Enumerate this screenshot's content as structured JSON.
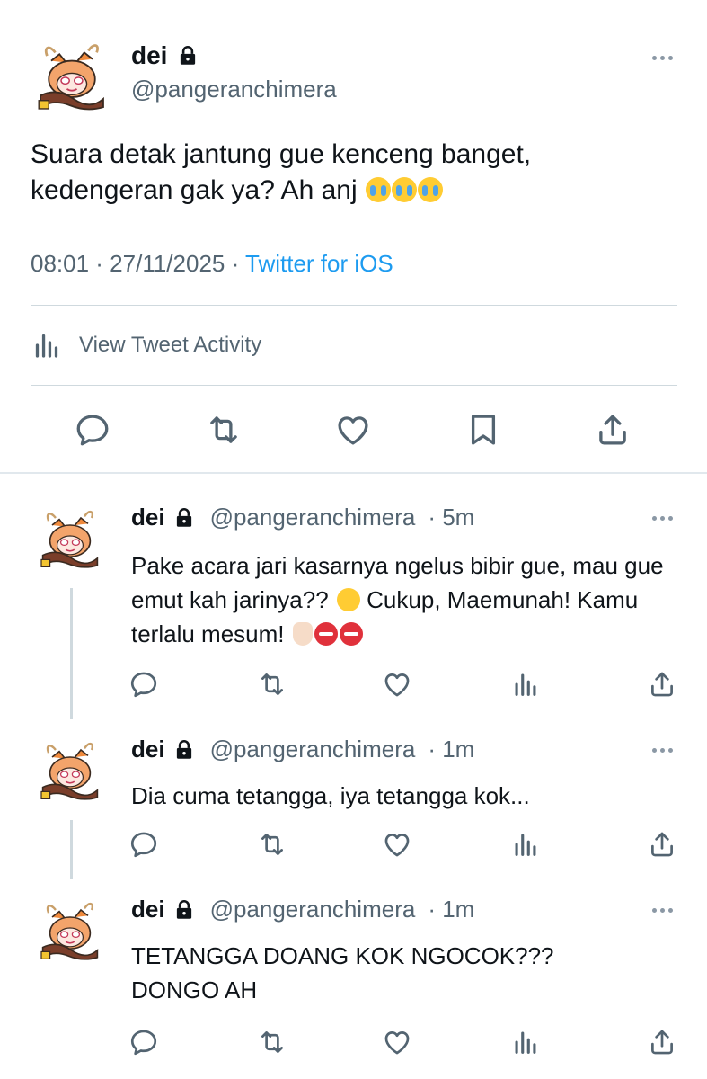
{
  "main_tweet": {
    "name": "dei",
    "handle": "@pangeranchimera",
    "text": "Suara detak jantung gue kenceng banget, kedengeran gak ya? Ah anj",
    "time": "08:01 · 27/11/2025 · ",
    "source": "Twitter for iOS",
    "activity_label": "View Tweet Activity"
  },
  "replies": [
    {
      "name": "dei",
      "handle": "@pangeranchimera",
      "time": "· 5m",
      "text_a": "Pake acara jari kasarnya ngelus bibir gue, mau gue emut kah jarinya??",
      "text_b": "Cukup, Maemunah! Kamu terlalu mesum!"
    },
    {
      "name": "dei",
      "handle": "@pangeranchimera",
      "time": "· 1m",
      "text": "Dia cuma tetangga, iya tetangga kok..."
    },
    {
      "name": "dei",
      "handle": "@pangeranchimera",
      "time": "· 1m",
      "text": "TETANGGA DOANG KOK NGOCOK??? DONGO AH"
    }
  ],
  "icons": [
    "more-icon",
    "lock-icon",
    "chart-icon",
    "reply-icon",
    "retweet-icon",
    "like-icon",
    "bookmark-icon",
    "share-icon",
    "activity-icon"
  ],
  "colors": {
    "link": "#1d9bf0",
    "secondary": "#536471",
    "icon": "#536471",
    "divider": "#cfd9de"
  }
}
